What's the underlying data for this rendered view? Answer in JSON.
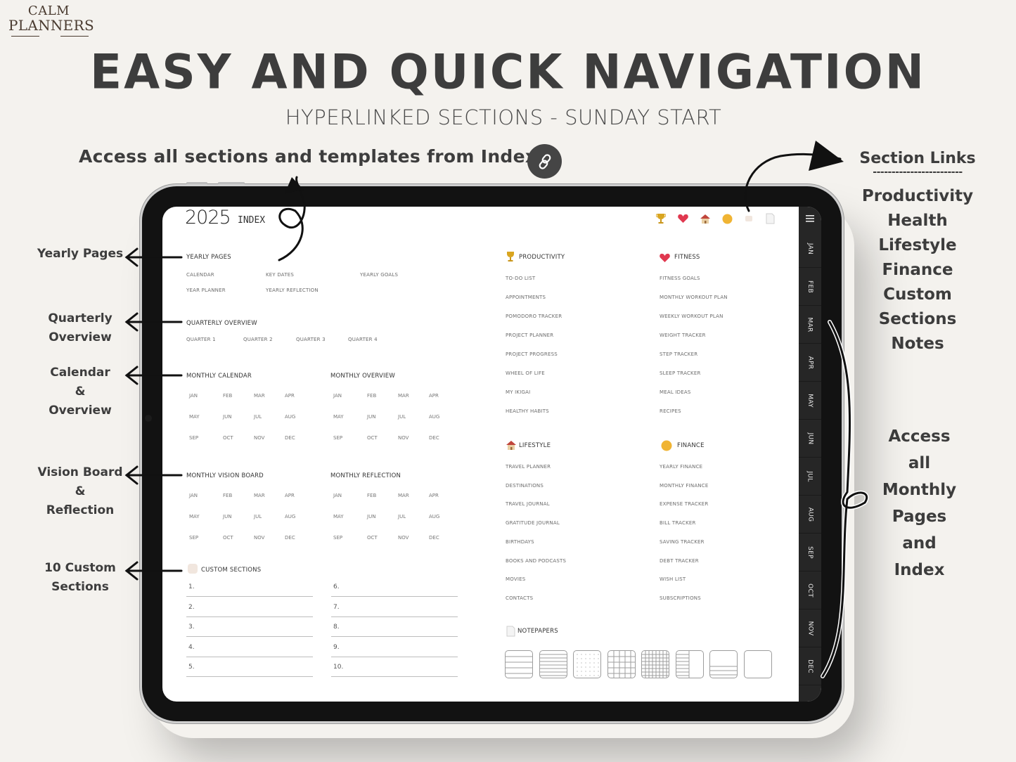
{
  "brand": {
    "line1": "CALM",
    "line2": "PLANNERS"
  },
  "headline": "EASY AND QUICK NAVIGATION",
  "subheadline": "HYPERLINKED SECTIONS - SUNDAY START",
  "index_callout": "Access all sections and templates from Index",
  "left_callouts": [
    {
      "lines": [
        "Yearly Pages"
      ]
    },
    {
      "lines": [
        "Quarterly",
        "Overview"
      ]
    },
    {
      "lines": [
        "Calendar",
        "&",
        "Overview"
      ]
    },
    {
      "lines": [
        "Vision Board",
        "&",
        "Reflection"
      ]
    },
    {
      "lines": [
        "10 Custom",
        "Sections"
      ]
    }
  ],
  "section_links": {
    "title": "Section Links",
    "divider": "------------------------",
    "items": [
      "Productivity",
      "Health",
      "Lifestyle",
      "Finance",
      "Custom Sections",
      "Notes"
    ]
  },
  "monthly_callout": [
    "Access",
    "all",
    "Monthly",
    "Pages",
    "and",
    "Index"
  ],
  "planner": {
    "year": "2025",
    "page_title": "INDEX",
    "top_icons": [
      "trophy-icon",
      "heart-icon",
      "house-icon",
      "coin-icon",
      "custom-icon",
      "notepaper-icon"
    ],
    "side_tabs": [
      "JAN",
      "FEB",
      "MAR",
      "APR",
      "MAY",
      "JUN",
      "JUL",
      "AUG",
      "SEP",
      "OCT",
      "NOV",
      "DEC"
    ],
    "yearly_pages": {
      "title": "YEARLY PAGES",
      "items": [
        "CALENDAR",
        "KEY DATES",
        "YEARLY GOALS",
        "YEAR PLANNER",
        "YEARLY REFLECTION"
      ]
    },
    "quarterly": {
      "title": "QUARTERLY OVERVIEW",
      "items": [
        "QUARTER 1",
        "QUARTER 2",
        "QUARTER 3",
        "QUARTER 4"
      ]
    },
    "months": [
      "JAN",
      "FEB",
      "MAR",
      "APR",
      "MAY",
      "JUN",
      "JUL",
      "AUG",
      "SEP",
      "OCT",
      "NOV",
      "DEC"
    ],
    "monthly_blocks": [
      {
        "title": "MONTHLY CALENDAR"
      },
      {
        "title": "MONTHLY OVERVIEW"
      },
      {
        "title": "MONTHLY VISION BOARD"
      },
      {
        "title": "MONTHLY REFLECTION"
      }
    ],
    "custom_sections": {
      "title": "CUSTOM SECTIONS",
      "items": [
        "1.",
        "2.",
        "3.",
        "4.",
        "5.",
        "6.",
        "7.",
        "8.",
        "9.",
        "10."
      ]
    },
    "productivity": {
      "title": "PRODUCTIVITY",
      "items": [
        "TO-DO LIST",
        "APPOINTMENTS",
        "POMODORO TRACKER",
        "PROJECT PLANNER",
        "PROJECT PROGRESS",
        "WHEEL OF LIFE",
        "MY IKIGAI",
        "HEALTHY HABITS"
      ]
    },
    "fitness": {
      "title": "FITNESS",
      "items": [
        "FITNESS GOALS",
        "MONTHLY WORKOUT PLAN",
        "WEEKLY WORKOUT PLAN",
        "WEIGHT TRACKER",
        "STEP TRACKER",
        "SLEEP TRACKER",
        "MEAL IDEAS",
        "RECIPES"
      ]
    },
    "lifestyle": {
      "title": "LIFESTYLE",
      "items": [
        "TRAVEL PLANNER",
        "DESTINATIONS",
        "TRAVEL JOURNAL",
        "GRATITUDE JOURNAL",
        "BIRTHDAYS",
        "BOOKS AND PODCASTS",
        "MOVIES",
        "CONTACTS"
      ]
    },
    "finance": {
      "title": "FINANCE",
      "items": [
        "YEARLY FINANCE",
        "MONTHLY FINANCE",
        "EXPENSE TRACKER",
        "BILL TRACKER",
        "SAVING TRACKER",
        "DEBT TRACKER",
        "WISH LIST",
        "SUBSCRIPTIONS"
      ]
    },
    "notepapers": {
      "title": "NOTEPAPERS",
      "templates": [
        "lined-wide",
        "lined-narrow",
        "dotted",
        "grid-large",
        "grid-small",
        "cornell",
        "bottom-lined",
        "blank"
      ]
    }
  },
  "colors": {
    "background": "#f4f2ee",
    "text_dark": "#3d3d3d",
    "tablet_bezel": "#121212",
    "side_tab": "#262626",
    "brand": "#4a3b30",
    "trophy": "#d9a520",
    "heart": "#e0384f",
    "coin": "#f0b433"
  }
}
